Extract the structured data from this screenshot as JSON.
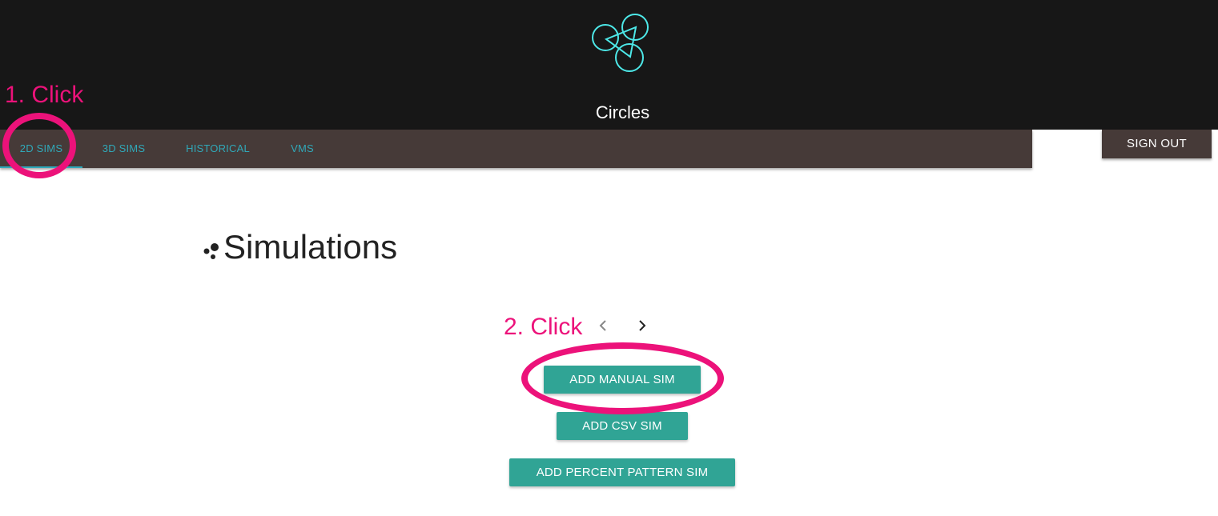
{
  "header": {
    "logo": "circles-logo-icon",
    "title": "Circles"
  },
  "tabs": [
    {
      "label": "2D SIMS",
      "active": true
    },
    {
      "label": "3D SIMS",
      "active": false
    },
    {
      "label": "HISTORICAL",
      "active": false
    },
    {
      "label": "VMS",
      "active": false
    }
  ],
  "signout_label": "SIGN OUT",
  "main": {
    "heading": "Simulations",
    "heading_icon": "dots-icon",
    "pager": {
      "prev_icon": "chevron-left-icon",
      "next_icon": "chevron-right-icon"
    },
    "buttons": {
      "manual": "ADD MANUAL SIM",
      "csv": "ADD CSV SIM",
      "percent": "ADD PERCENT PATTERN SIM"
    }
  },
  "annotations": {
    "step1": "1. Click",
    "step2": "2. Click"
  },
  "colors": {
    "header_bg": "#171717",
    "tabs_bg": "#463a38",
    "tab_text": "#30a8b8",
    "logo_stroke": "#4de8e8",
    "button_bg": "#30a495",
    "annotation": "#ec127a"
  }
}
